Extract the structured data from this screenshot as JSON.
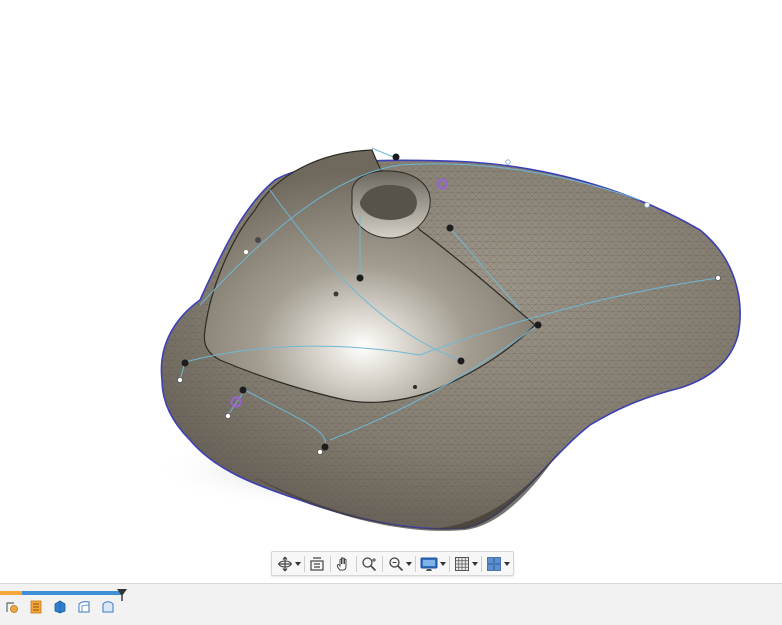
{
  "app": {
    "viewport_background": "#ffffff",
    "model_color": "#8a8377",
    "sketch_line_color": "#6fb8d6",
    "boundary_color": "#4a4fc4",
    "constraint_color": "#9a62d6"
  },
  "nav_toolbar": {
    "tools": [
      {
        "icon": "orbit-icon",
        "has_dropdown": true
      },
      {
        "icon": "look-at-icon",
        "has_dropdown": false
      },
      {
        "icon": "pan-hand-icon",
        "has_dropdown": false
      },
      {
        "icon": "zoom-icon",
        "has_dropdown": false
      },
      {
        "icon": "fit-zoom-icon",
        "has_dropdown": true
      },
      {
        "icon": "display-settings-icon",
        "has_dropdown": true
      },
      {
        "icon": "grid-settings-icon",
        "has_dropdown": true
      },
      {
        "icon": "viewports-icon",
        "has_dropdown": true
      }
    ]
  },
  "timeline": {
    "progress_color": "#3f8fd6",
    "history_color": "#f4a83b",
    "items": [
      {
        "icon": "feature-sketch-icon"
      },
      {
        "icon": "feature-form-icon"
      },
      {
        "icon": "feature-body-icon"
      },
      {
        "icon": "feature-patch-icon"
      },
      {
        "icon": "feature-surface-icon"
      }
    ]
  }
}
